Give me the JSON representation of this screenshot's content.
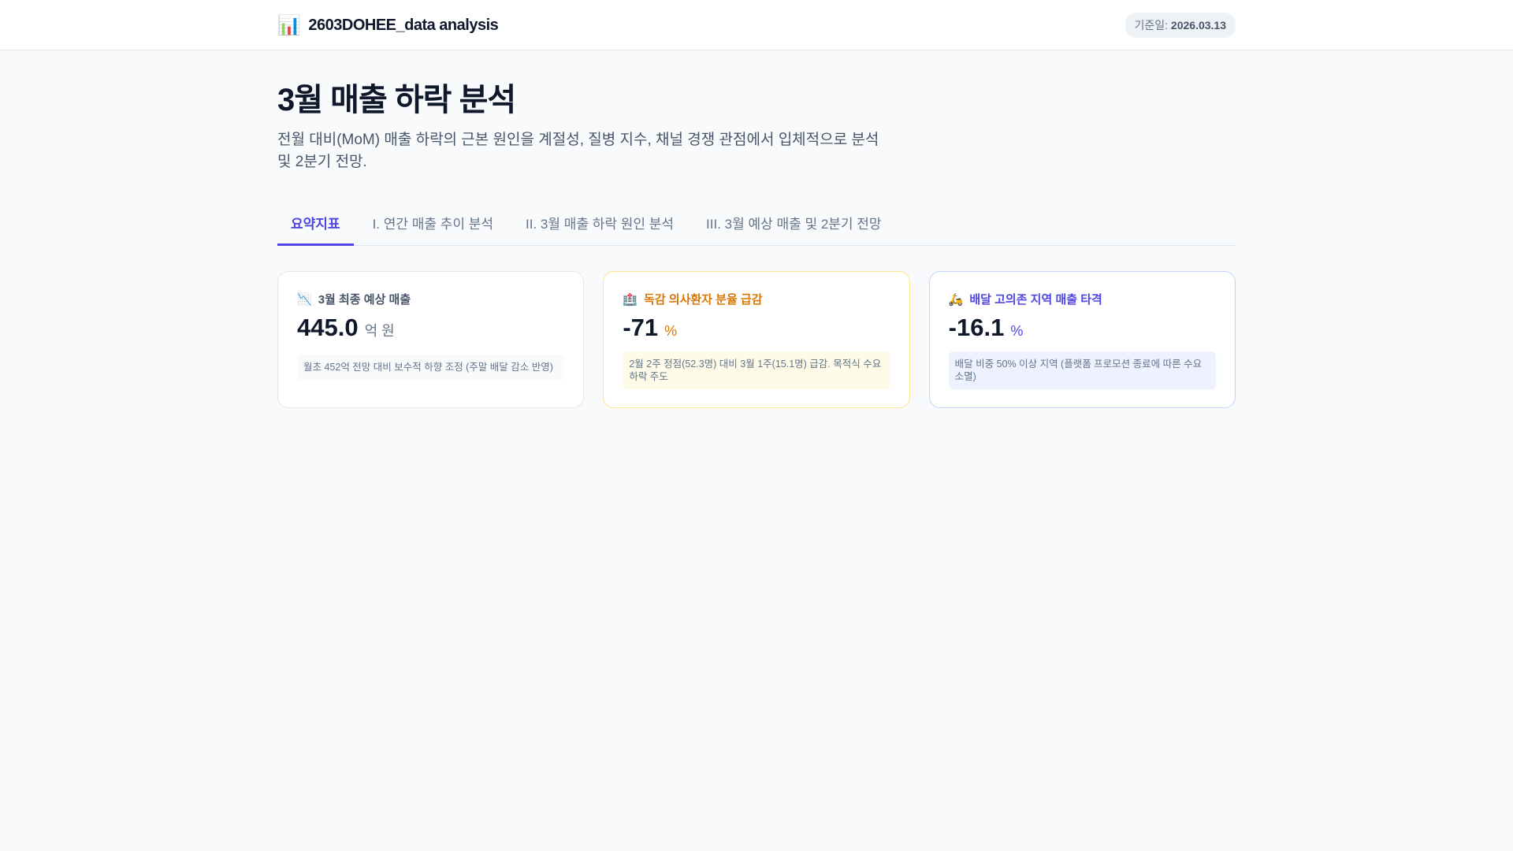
{
  "header": {
    "icon": "bar-chart-icon",
    "title": "2603DOHEE_data analysis",
    "date_label": "기준일:",
    "date_value": "2026.03.13"
  },
  "page": {
    "title": "3월 매출 하락 분석",
    "subtitle": "전월 대비(MoM) 매출 하락의 근본 원인을 계절성, 질병 지수, 채널 경쟁 관점에서 입체적으로 분석 및 2분기 전망."
  },
  "tabs": [
    {
      "label": "요약지표",
      "active": true
    },
    {
      "label": "I. 연간 매출 추이 분석"
    },
    {
      "label": "II. 3월 매출 하락 원인 분석"
    },
    {
      "label": "III. 3월 예상 매출 및 2분기 전망"
    }
  ],
  "cards": [
    {
      "icon": "📉",
      "title": "3월 최종 예상 매출",
      "value": "445.0",
      "unit": "억 원",
      "note": "월초 452억 전망 대비 보수적 하향 조정 (주말 배달 감소 반영)"
    },
    {
      "icon": "🏥",
      "title": "독감 의사환자 분율 급감",
      "value": "-71",
      "unit": "%",
      "note": "2월 2주 정점(52.3명) 대비 3월 1주(15.1명) 급감. 목적식 수요 하락 주도"
    },
    {
      "icon": "🛵",
      "title": "배달 고의존 지역 매출 타격",
      "value": "-16.1",
      "unit": "%",
      "note": "배달 비중 50% 이상 지역 (플랫폼 프로모션 종료에 따른 수요 소멸)"
    }
  ],
  "colors": {
    "accent": "#4f46e5",
    "warning": "#d97706"
  }
}
